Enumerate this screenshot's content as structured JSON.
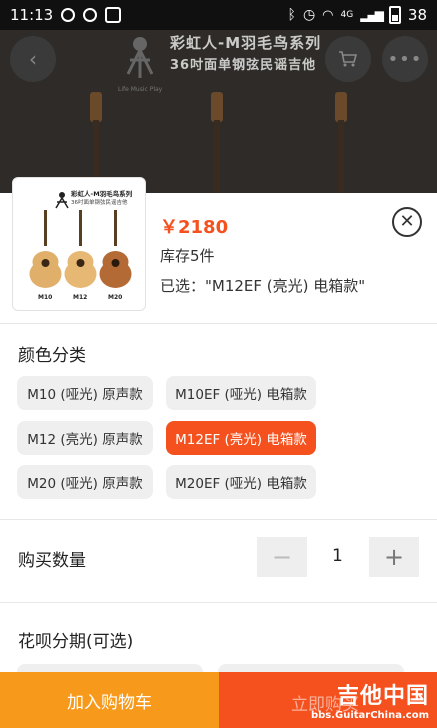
{
  "status_bar": {
    "time": "11:13",
    "battery": "38",
    "network": "4G"
  },
  "banner": {
    "title": "彩虹人-M羽毛鸟系列",
    "subtitle": "36吋面单钢弦民谣吉他",
    "logo_text": "Life Music Play"
  },
  "product": {
    "thumb_title": "彩虹人-M羽毛鸟系列",
    "thumb_subtitle": "36吋面单钢弦民谣吉他",
    "thumb_labels": [
      "M10",
      "M12",
      "M20"
    ],
    "price": "￥2180",
    "stock": "库存5件",
    "selected": "已选：\"M12EF (亮光) 电箱款\""
  },
  "color_section": {
    "title": "颜色分类",
    "options": [
      {
        "label": "M10 (哑光) 原声款",
        "active": false
      },
      {
        "label": "M10EF (哑光) 电箱款",
        "active": false
      },
      {
        "label": "M12 (亮光) 原声款",
        "active": false
      },
      {
        "label": "M12EF (亮光) 电箱款",
        "active": true
      },
      {
        "label": "M20 (哑光) 原声款",
        "active": false
      },
      {
        "label": "M20EF (哑光) 电箱款",
        "active": false
      }
    ]
  },
  "quantity": {
    "label": "购买数量",
    "value": "1",
    "minus": "−",
    "plus": "+"
  },
  "installment": {
    "title": "花呗分期(可选)"
  },
  "footer": {
    "add_to_cart": "加入购物车",
    "buy_now": "立即购买"
  },
  "watermark": {
    "main": "吉他中国",
    "url": "bbs.GuitarChina.com"
  },
  "colors": {
    "accent": "#f4511e",
    "cart": "#f79a1c"
  }
}
